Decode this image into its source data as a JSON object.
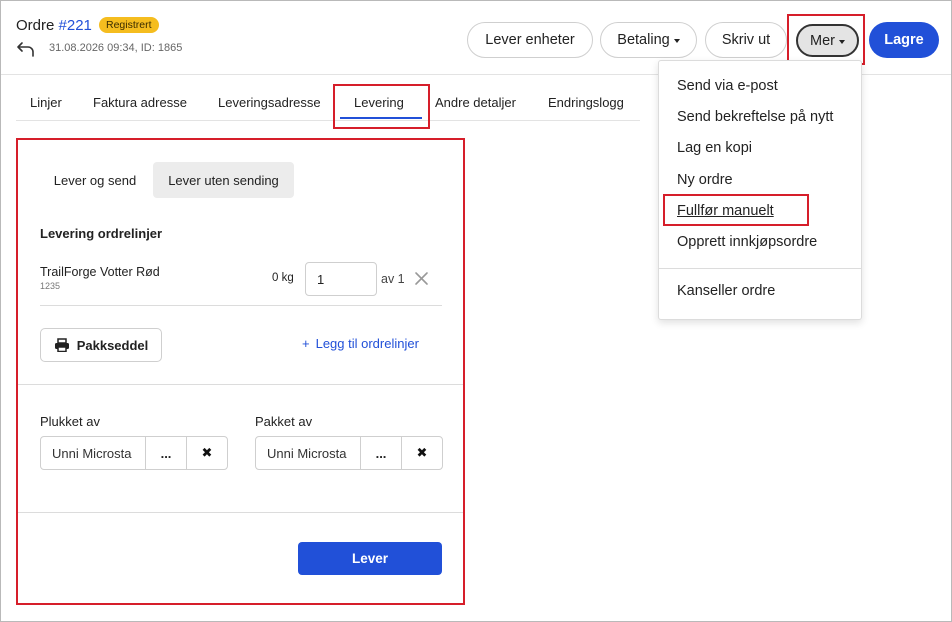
{
  "header": {
    "order_label": "Ordre",
    "order_number": "#221",
    "status_badge": "Registrert",
    "meta": "31.08.2026 09:34, ID: 1865",
    "buttons": {
      "deliver_units": "Lever enheter",
      "payment": "Betaling",
      "print": "Skriv ut",
      "more": "Mer",
      "save": "Lagre"
    }
  },
  "tabs": [
    {
      "label": "Linjer"
    },
    {
      "label": "Faktura adresse"
    },
    {
      "label": "Leveringsadresse"
    },
    {
      "label": "Levering",
      "active": true
    },
    {
      "label": "Andre detaljer"
    },
    {
      "label": "Endringslogg"
    }
  ],
  "delivery": {
    "segments": [
      "Lever og send",
      "Lever uten sending"
    ],
    "selected_segment": "Lever uten sending",
    "section_title": "Levering ordrelinjer",
    "line": {
      "name": "TrailForge Votter Rød",
      "sku": "1235",
      "weight": "0 kg",
      "quantity": "1",
      "of_total": "av 1"
    },
    "packing_slip_button": "Pakkseddel",
    "add_lines_link": "Legg til ordrelinjer",
    "picked_by": {
      "label": "Plukket av",
      "value": "Unni Microsta",
      "more": "...",
      "clear": "✖"
    },
    "packed_by": {
      "label": "Pakket av",
      "value": "Unni Microsta",
      "more": "...",
      "clear": "✖"
    },
    "deliver_button": "Lever"
  },
  "more_menu": {
    "items": [
      "Send via e-post",
      "Send bekreftelse på nytt",
      "Lag en kopi",
      "Ny ordre",
      "Fullfør manuelt",
      "Opprett innkjøpsordre",
      "Kanseller ordre"
    ]
  },
  "colors": {
    "accent": "#2150d8",
    "badge": "#f5bd1f",
    "highlight": "#d61e2a"
  }
}
